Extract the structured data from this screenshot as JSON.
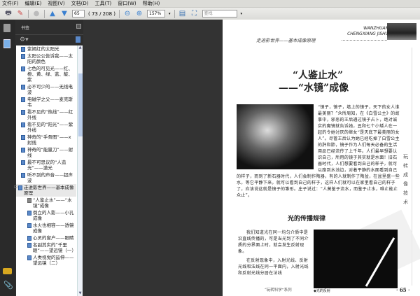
{
  "menu": [
    "文件(F)",
    "编辑(E)",
    "视图(V)",
    "文档(D)",
    "工具(T)",
    "窗口(W)",
    "帮助(H)"
  ],
  "toolbar": {
    "page_input": "65",
    "page_count": "( 73 / 208 )",
    "zoom": "157%",
    "search_placeholder": "查找"
  },
  "panel": {
    "title": "书签"
  },
  "bookmarks": [
    {
      "label": "紫嫣红的太阳光",
      "level": 1
    },
    {
      "label": "太阳公公告诉我——太阳的颜色",
      "level": 1
    },
    {
      "label": "七色的可见光——红、橙、黄、绿、蓝、靛、紫",
      "level": 1
    },
    {
      "label": "必不可少的——无线电波",
      "level": 1
    },
    {
      "label": "电磁学之父——麦克斯韦",
      "level": 1
    },
    {
      "label": "看不见的“热线”——红外线",
      "level": 1
    },
    {
      "label": "看不见的“阳光”——紫外线",
      "level": 1
    },
    {
      "label": "神奇的“手骨图”——x射线",
      "level": 1
    },
    {
      "label": "神奇的“能量刀”——射线",
      "level": 1
    },
    {
      "label": "最不可思议的“人造光”——激光",
      "level": 1
    },
    {
      "label": "听不到的声音——超声波",
      "level": 1
    },
    {
      "label": "走进影世界——基本成像原理",
      "level": 0
    },
    {
      "label": "“人鉴止水”——“水镜”成像",
      "level": 2,
      "selected": true
    },
    {
      "label": "倒立的人影——小孔成像",
      "level": 2
    },
    {
      "label": "水火也相容——透镜成像",
      "level": 2
    },
    {
      "label": "心灵的窗户——眼睛",
      "level": 2
    },
    {
      "label": "名副其实的“千里眼”——望远镜（一）",
      "level": 2
    },
    {
      "label": "人类视觉的延伸——望远镜（二）",
      "level": 2
    }
  ],
  "document": {
    "header_en_1": "WANZHUAN",
    "header_en_2": "CHENGXIANG JISHU",
    "header_cn": "走进影世界——基本成像原理",
    "title_1": "“人鉴止水”",
    "title_2": "——“水镜”成像",
    "para1": "“镜子，镜子，墙上的镜子，天下的女人谁最美丽？”众所周知，在《白雪公主》的故事中，邪恶的王后通过镜子占卜，绝对诚实的魔镜就告诉她，丑和七个小矮人在一起的令她讨厌的继女“是天底下最美丽的女人”。尽管王后认为她已经吃掉了白雪公主的肝和肺，镜子作为人们每天必备的生活用品已经流传了上千年。人们最早想要认识自己，所用的镜子其实就是水面！旧石器时代，人们想要看到自己的样子，就可以跑到水池边，对着平静的水面看到自己的样子，而到了新石器时代，人们会制作陶器，有的人就制作了陶盆，在盆里盛一些水，等它平静下来，就可以看到自己的样子，这样人们就可以在家里看自己的样子了，应该说这就是镜子的雏形。庄子说过：“人莫鉴于流水，而鉴于止水，唯止能止众止”。",
    "side_vertical": "玩转成像技术",
    "section_title": "光的传播规律",
    "para2": "我们知道光在同一均匀介质中是沿直线传播的，可是当光到了不同介质的分界面上时，就会发生反射现象。",
    "para3": "在反射现象中，入射光线、反射光线和法线在同一平面内，入射光线和反射光线分居在法线",
    "caption": "◆光的反射",
    "footer": "“玩转科学”系列",
    "page_number": "· 65 ·"
  }
}
